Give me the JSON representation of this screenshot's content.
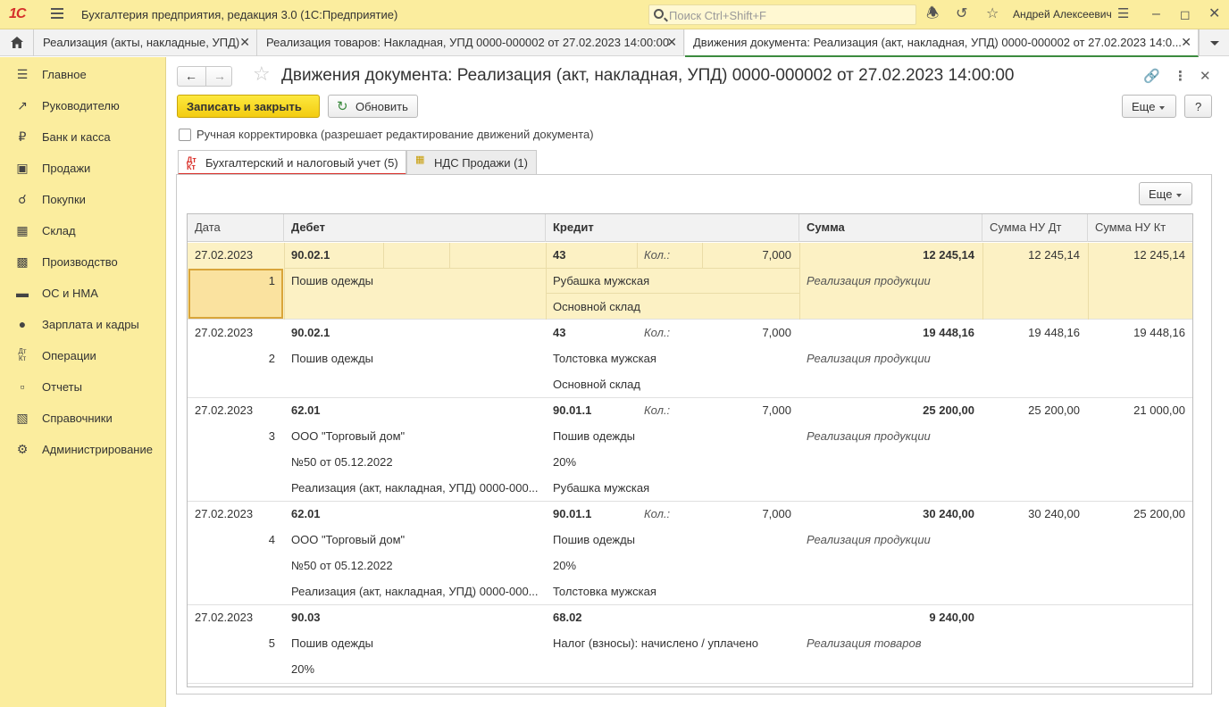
{
  "titlebar": {
    "logo": "1С",
    "app_title": "Бухгалтерия предприятия, редакция 3.0  (1С:Предприятие)",
    "search_placeholder": "Поиск Ctrl+Shift+F",
    "user": "Андрей Алексеевич",
    "icons": [
      "bell-icon",
      "history-icon",
      "star-icon",
      "settings-lines-icon",
      "minimize-icon",
      "maximize-icon",
      "close-icon"
    ]
  },
  "tabs": [
    {
      "label": "Реализация (акты, накладные, УПД)",
      "active": false
    },
    {
      "label": "Реализация товаров: Накладная, УПД 0000-000002 от 27.02.2023 14:00:00",
      "active": false
    },
    {
      "label": "Движения документа: Реализация (акт, накладная, УПД) 0000-000002 от 27.02.2023 14:0...",
      "active": true
    }
  ],
  "sidebar": {
    "items": [
      {
        "label": "Главное",
        "icon": "menu-lines-icon"
      },
      {
        "label": "Руководителю",
        "icon": "trend-icon"
      },
      {
        "label": "Банк и касса",
        "icon": "ruble-icon"
      },
      {
        "label": "Продажи",
        "icon": "bag-icon"
      },
      {
        "label": "Покупки",
        "icon": "cart-icon"
      },
      {
        "label": "Склад",
        "icon": "warehouse-icon"
      },
      {
        "label": "Производство",
        "icon": "factory-icon"
      },
      {
        "label": "ОС и НМА",
        "icon": "truck-icon"
      },
      {
        "label": "Зарплата и кадры",
        "icon": "person-icon"
      },
      {
        "label": "Операции",
        "icon": "dt-kt-icon"
      },
      {
        "label": "Отчеты",
        "icon": "bar-chart-icon"
      },
      {
        "label": "Справочники",
        "icon": "book-icon"
      },
      {
        "label": "Администрирование",
        "icon": "gear-icon"
      }
    ]
  },
  "form": {
    "title": "Движения документа: Реализация (акт, накладная, УПД) 0000-000002 от 27.02.2023 14:00:00",
    "save_close": "Записать и закрыть",
    "refresh": "Обновить",
    "more": "Еще",
    "help": "?",
    "manual_correction": "Ручная корректировка (разрешает редактирование движений документа)",
    "tab_accounting": "Бухгалтерский и налоговый учет (5)",
    "tab_vat": "НДС Продажи (1)",
    "table_more": "Еще"
  },
  "table": {
    "columns": [
      "Дата",
      "Дебет",
      "Кредит",
      "Сумма",
      "Сумма НУ Дт",
      "Сумма НУ Кт"
    ],
    "rows": [
      {
        "date": "27.02.2023",
        "num": "1",
        "debit": [
          "90.02.1",
          "Пошив одежды",
          ""
        ],
        "credit": [
          "43",
          "Рубашка мужская",
          "Основной склад"
        ],
        "qty_label": "Кол.:",
        "qty": "7,000",
        "sum": "12 245,14",
        "sum_note": "Реализация продукции",
        "nu_dt": "12 245,14",
        "nu_kt": "12 245,14"
      },
      {
        "date": "27.02.2023",
        "num": "2",
        "debit": [
          "90.02.1",
          "Пошив одежды",
          ""
        ],
        "credit": [
          "43",
          "Толстовка мужская",
          "Основной склад"
        ],
        "qty_label": "Кол.:",
        "qty": "7,000",
        "sum": "19 448,16",
        "sum_note": "Реализация продукции",
        "nu_dt": "19 448,16",
        "nu_kt": "19 448,16"
      },
      {
        "date": "27.02.2023",
        "num": "3",
        "debit": [
          "62.01",
          "ООО \"Торговый дом\"",
          "№50 от 05.12.2022",
          "Реализация (акт, накладная, УПД) 0000-000..."
        ],
        "credit": [
          "90.01.1",
          "Пошив одежды",
          "20%",
          "Рубашка мужская"
        ],
        "qty_label": "Кол.:",
        "qty": "7,000",
        "sum": "25 200,00",
        "sum_note": "Реализация продукции",
        "nu_dt": "25 200,00",
        "nu_kt": "21 000,00"
      },
      {
        "date": "27.02.2023",
        "num": "4",
        "debit": [
          "62.01",
          "ООО \"Торговый дом\"",
          "№50 от 05.12.2022",
          "Реализация (акт, накладная, УПД) 0000-000..."
        ],
        "credit": [
          "90.01.1",
          "Пошив одежды",
          "20%",
          "Толстовка мужская"
        ],
        "qty_label": "Кол.:",
        "qty": "7,000",
        "sum": "30 240,00",
        "sum_note": "Реализация продукции",
        "nu_dt": "30 240,00",
        "nu_kt": "25 200,00"
      },
      {
        "date": "27.02.2023",
        "num": "5",
        "debit": [
          "90.03",
          "Пошив одежды",
          "20%"
        ],
        "credit": [
          "68.02",
          "Налог (взносы): начислено / уплачено",
          ""
        ],
        "qty_label": "",
        "qty": "",
        "sum": "9 240,00",
        "sum_note": "Реализация товаров",
        "nu_dt": "",
        "nu_kt": ""
      }
    ]
  }
}
